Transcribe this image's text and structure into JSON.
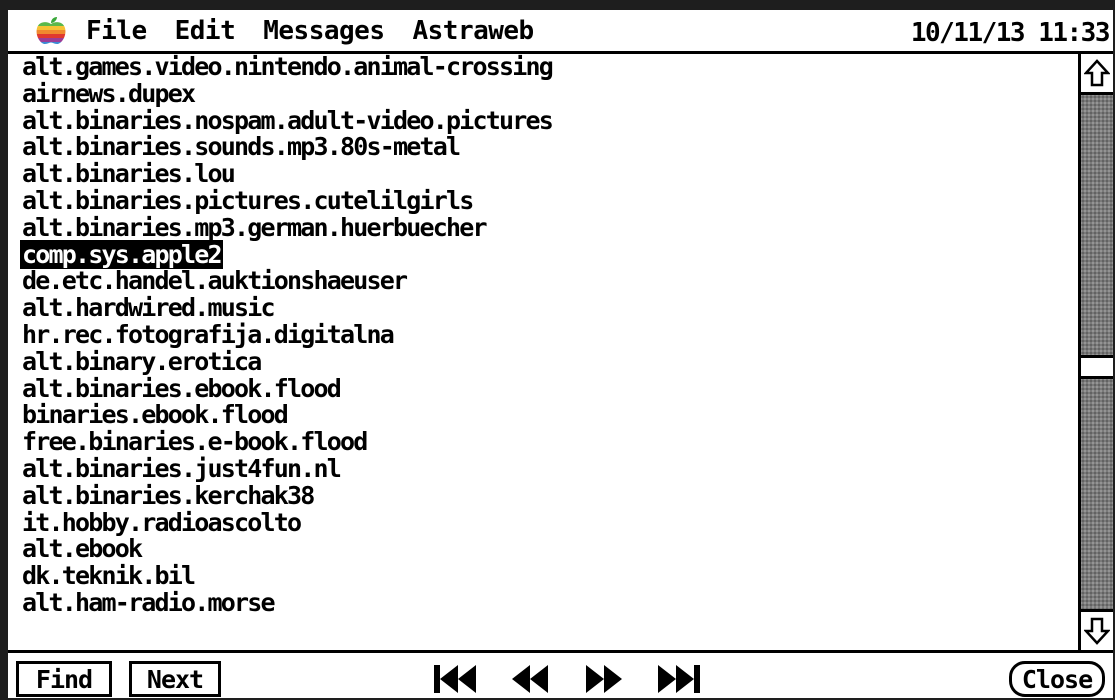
{
  "menubar": {
    "apple_icon": "apple-logo-rainbow",
    "items": [
      "File",
      "Edit",
      "Messages",
      "Astraweb"
    ],
    "clock": "10/11/13 11:33"
  },
  "newsgroups": {
    "items": [
      "alt.games.video.nintendo.animal-crossing",
      "airnews.dupex",
      "alt.binaries.nospam.adult-video.pictures",
      "alt.binaries.sounds.mp3.80s-metal",
      "alt.binaries.lou",
      "alt.binaries.pictures.cutelilgirls",
      "alt.binaries.mp3.german.huerbuecher",
      "comp.sys.apple2",
      "de.etc.handel.auktionshaeuser",
      "alt.hardwired.music",
      "hr.rec.fotografija.digitalna",
      "alt.binary.erotica",
      "alt.binaries.ebook.flood",
      "binaries.ebook.flood",
      "free.binaries.e-book.flood",
      "alt.binaries.just4fun.nl",
      "alt.binaries.kerchak38",
      "it.hobby.radioascolto",
      "alt.ebook",
      "dk.teknik.bil",
      "alt.ham-radio.morse"
    ],
    "selected_index": 7
  },
  "scrollbar": {
    "up_icon": "scroll-up-arrow-icon",
    "down_icon": "scroll-down-arrow-icon",
    "thumb_position_fraction": 0.53
  },
  "bottombar": {
    "find_label": "Find",
    "next_label": "Next",
    "close_label": "Close",
    "transport_icons": [
      "skip-to-start-icon",
      "rewind-icon",
      "fast-forward-icon",
      "skip-to-end-icon"
    ]
  },
  "colors": {
    "background": "#ffffff",
    "foreground": "#000000",
    "scroll_track": "#7a7a7a"
  }
}
